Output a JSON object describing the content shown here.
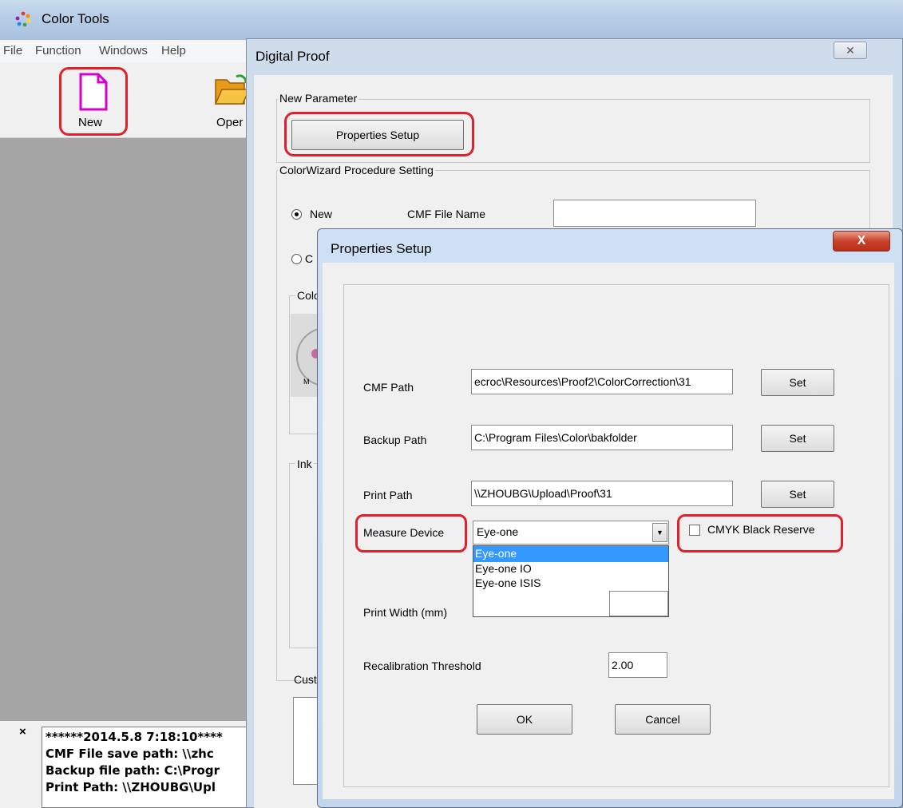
{
  "app": {
    "title": "Color Tools"
  },
  "menu": [
    "File",
    "Function",
    "Windows",
    "Help"
  ],
  "toolbar": {
    "new_label": "New",
    "open_label": "Oper"
  },
  "log": {
    "lines": [
      "******2014.5.8 7:18:10****",
      "CMF File save path:  \\\\zhc",
      "Backup file path:  C:\\Progr",
      "Print Path:  \\\\ZHOUBG\\Upl"
    ]
  },
  "digital_proof": {
    "title": "Digital Proof",
    "close_glyph": "✕",
    "new_parameter_label": "New Parameter",
    "properties_button": "Properties Setup",
    "procedure_label": "ColorWizard Procedure Setting",
    "radio_new_label": "New",
    "radio_other_label": "C",
    "cmf_file_name_label": "CMF File Name",
    "color_group_label": "Colo",
    "ink_group_label": "Ink",
    "gauge_letter": "M",
    "custom_label": "Custo"
  },
  "properties_setup": {
    "title": "Properties Setup",
    "close_glyph": "X",
    "cmf_path_label": "CMF Path",
    "cmf_path_value": "ecroc\\Resources\\Proof2\\ColorCorrection\\31",
    "backup_path_label": "Backup Path",
    "backup_path_value": "C:\\Program Files\\Color\\bakfolder",
    "print_path_label": "Print Path",
    "print_path_value": "\\\\ZHOUBG\\Upload\\Proof\\31",
    "set_label": "Set",
    "measure_device_label": "Measure Device",
    "measure_device_value": "Eye-one",
    "measure_device_options": [
      "Eye-one",
      "Eye-one IO",
      "Eye-one ISIS"
    ],
    "cmyk_label": "CMYK Black Reserve",
    "print_width_label": "Print Width (mm)",
    "recal_label": "Recalibration Threshold",
    "recal_value": "2.00",
    "ok_label": "OK",
    "cancel_label": "Cancel"
  },
  "colors": {
    "highlight_ring": "#e0202a",
    "selection": "#3399ff",
    "workspace": "#a5a5a5"
  }
}
